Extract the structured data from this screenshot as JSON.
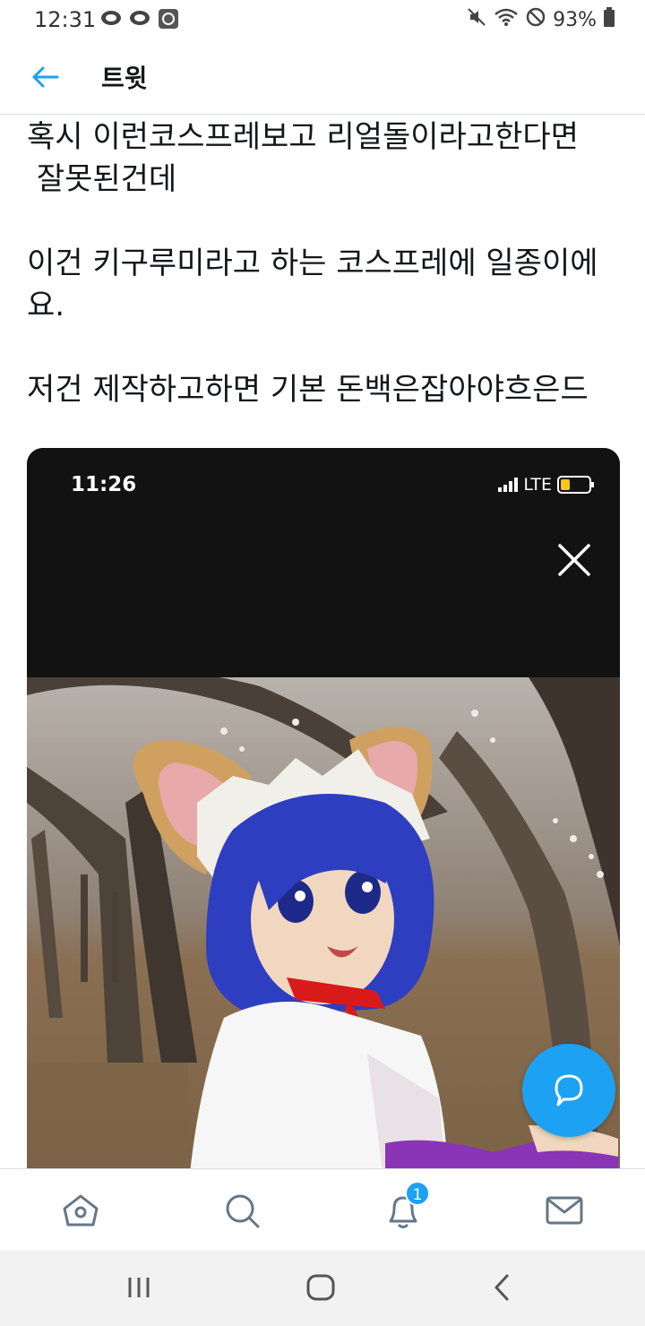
{
  "status_bar": {
    "time": "12:31",
    "battery": "93%"
  },
  "header": {
    "title": "트윗"
  },
  "tweet": {
    "paragraphs": [
      "혹시 이런코스프레보고 리얼돌이라고한다면\n 잘못된건데",
      "이건 키구루미라고 하는 코스프레에 일종이에요.",
      "저건 제작하고하면 기본 돈백은잡아야흐은드"
    ]
  },
  "media": {
    "embedded_time": "11:26",
    "embedded_network": "LTE"
  },
  "bottom_nav": {
    "notification_count": "1"
  },
  "colors": {
    "accent": "#1da1f2",
    "text": "#14171a",
    "divider": "#d8dee3"
  },
  "icons": [
    "back-arrow-icon",
    "home-icon",
    "search-icon",
    "bell-icon",
    "mail-icon",
    "compose-reply-icon",
    "close-icon",
    "recent-apps-icon",
    "home-circle-icon",
    "back-chevron-icon"
  ]
}
